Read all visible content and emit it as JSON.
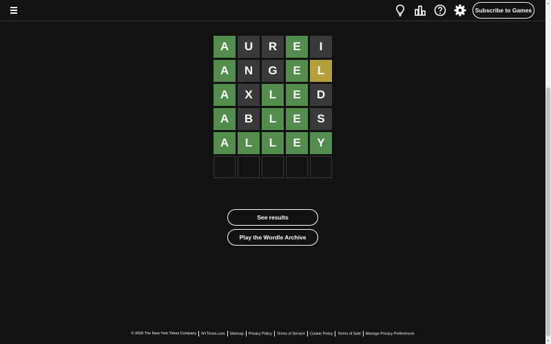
{
  "header": {
    "menu_icon": "hamburger-menu-icon",
    "icons": [
      "lightbulb-icon",
      "stats-icon",
      "help-icon",
      "settings-icon"
    ],
    "subscribe_label": "Subscribe to Games"
  },
  "board": {
    "rows": [
      {
        "letters": [
          "A",
          "U",
          "R",
          "E",
          "I"
        ],
        "states": [
          "correct",
          "absent",
          "absent",
          "correct",
          "absent"
        ]
      },
      {
        "letters": [
          "A",
          "N",
          "G",
          "E",
          "L"
        ],
        "states": [
          "correct",
          "absent",
          "absent",
          "correct",
          "present"
        ]
      },
      {
        "letters": [
          "A",
          "X",
          "L",
          "E",
          "D"
        ],
        "states": [
          "correct",
          "absent",
          "correct",
          "correct",
          "absent"
        ]
      },
      {
        "letters": [
          "A",
          "B",
          "L",
          "E",
          "S"
        ],
        "states": [
          "correct",
          "absent",
          "correct",
          "correct",
          "absent"
        ]
      },
      {
        "letters": [
          "A",
          "L",
          "L",
          "E",
          "Y"
        ],
        "states": [
          "correct",
          "correct",
          "correct",
          "correct",
          "correct"
        ]
      },
      {
        "letters": [
          "",
          "",
          "",
          "",
          ""
        ],
        "states": [
          "empty",
          "empty",
          "empty",
          "empty",
          "empty"
        ]
      }
    ]
  },
  "actions": {
    "see_results": "See results",
    "play_archive": "Play the Wordle Archive"
  },
  "footer": {
    "links": [
      "© 2026 The New York Times Company",
      "NYTimes.com",
      "Sitemap",
      "Privacy Policy",
      "Terms of Service",
      "Cookie Policy",
      "Terms of Sale",
      "Manage Privacy Preferences"
    ]
  },
  "colors": {
    "background": "#121213",
    "correct": "#538d4e",
    "present": "#b59f3b",
    "absent": "#3a3a3c"
  }
}
